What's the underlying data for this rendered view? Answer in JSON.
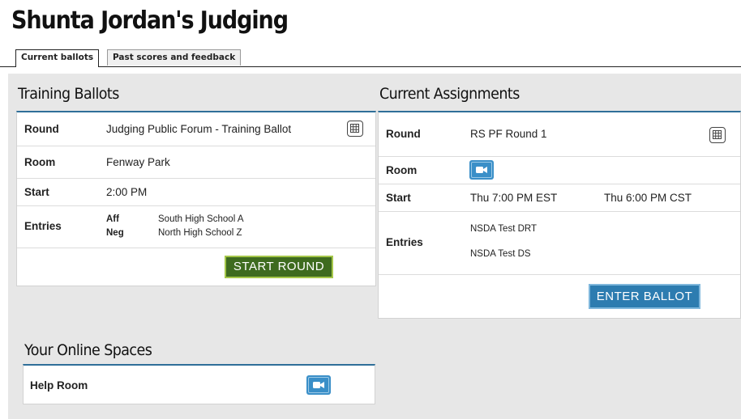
{
  "page": {
    "title": "Shunta Jordan's Judging"
  },
  "tabs": [
    {
      "label": "Current ballots",
      "active": true
    },
    {
      "label": "Past scores and feedback",
      "active": false
    }
  ],
  "training": {
    "title": "Training Ballots",
    "round_label": "Round",
    "round_value": "Judging Public Forum - Training Ballot",
    "room_label": "Room",
    "room_value": "Fenway Park",
    "start_label": "Start",
    "start_value": "2:00 PM",
    "entries_label": "Entries",
    "entries": [
      {
        "side": "Aff",
        "name": "South High School A"
      },
      {
        "side": "Neg",
        "name": "North High School Z"
      }
    ],
    "button_label": "START ROUND"
  },
  "assignments": {
    "title": "Current Assignments",
    "round_label": "Round",
    "round_value": "RS PF Round 1",
    "room_label": "Room",
    "start_label": "Start",
    "start_value": "Thu 7:00 PM EST",
    "start_local": "Thu 6:00 PM CST",
    "entries_label": "Entries",
    "entries": [
      "NSDA Test DRT",
      "NSDA Test DS"
    ],
    "button_label": "ENTER BALLOT"
  },
  "online": {
    "title": "Your Online Spaces",
    "room_label": "Help Room"
  },
  "icons": {
    "calendar": "calendar-icon",
    "video": "video-camera-icon"
  },
  "colors": {
    "accent": "#2f6f99",
    "green_button": "#3e6b1f",
    "blue_button": "#2d7cb0",
    "video_button": "#3a8fc8"
  }
}
